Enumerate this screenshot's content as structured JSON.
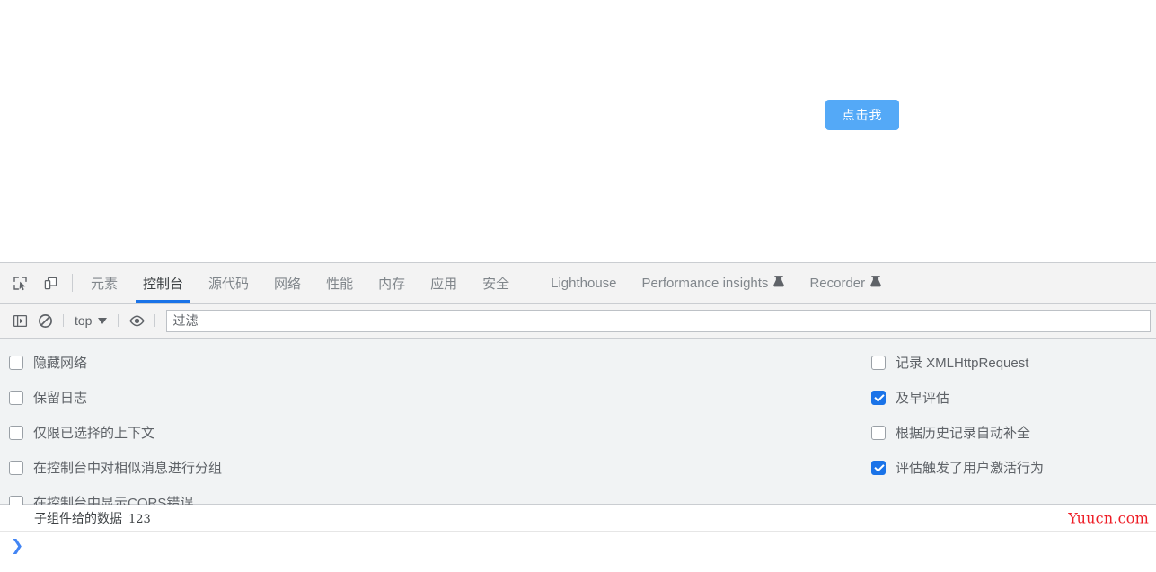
{
  "page": {
    "button_label": "点击我",
    "button_color": "#54a9f7"
  },
  "devtools": {
    "toolbar_icons": [
      {
        "name": "inspect-element-icon",
        "title": "检查元素"
      },
      {
        "name": "device-toolbar-icon",
        "title": "切换设备工具栏"
      }
    ],
    "tabs": [
      {
        "label": "元素",
        "active": false,
        "experimental": false
      },
      {
        "label": "控制台",
        "active": true,
        "experimental": false
      },
      {
        "label": "源代码",
        "active": false,
        "experimental": false
      },
      {
        "label": "网络",
        "active": false,
        "experimental": false
      },
      {
        "label": "性能",
        "active": false,
        "experimental": false
      },
      {
        "label": "内存",
        "active": false,
        "experimental": false
      },
      {
        "label": "应用",
        "active": false,
        "experimental": false
      },
      {
        "label": "安全",
        "active": false,
        "experimental": false
      },
      {
        "label": "Lighthouse",
        "active": false,
        "experimental": false
      },
      {
        "label": "Performance insights",
        "active": false,
        "experimental": true
      },
      {
        "label": "Recorder",
        "active": false,
        "experimental": true
      }
    ],
    "active_tab_underline_color": "#1a73e8"
  },
  "console_toolbar": {
    "sidebar_toggle_icon": "console-sidebar-icon",
    "clear_console_icon": "clear-console-icon",
    "context_selector": "top",
    "live_expression_icon": "eye-icon",
    "filter_placeholder": "过滤",
    "filter_value": ""
  },
  "console_settings": {
    "left": [
      {
        "label": "隐藏网络",
        "checked": false
      },
      {
        "label": "保留日志",
        "checked": false
      },
      {
        "label": "仅限已选择的上下文",
        "checked": false
      },
      {
        "label": "在控制台中对相似消息进行分组",
        "checked": false
      },
      {
        "label": "在控制台中显示CORS错误",
        "checked": false
      }
    ],
    "right": [
      {
        "label": "记录 XMLHttpRequest",
        "checked": false
      },
      {
        "label": "及早评估",
        "checked": true
      },
      {
        "label": "根据历史记录自动补全",
        "checked": false
      },
      {
        "label": "评估触发了用户激活行为",
        "checked": true
      }
    ],
    "checked_color": "#1a73e8"
  },
  "console_output": {
    "messages": [
      {
        "text": "子组件给的数据",
        "value": "123"
      }
    ],
    "watermark": "Yuucn.com",
    "watermark_color": "#ee1c25",
    "prompt_symbol": "❯",
    "prompt_value": ""
  }
}
